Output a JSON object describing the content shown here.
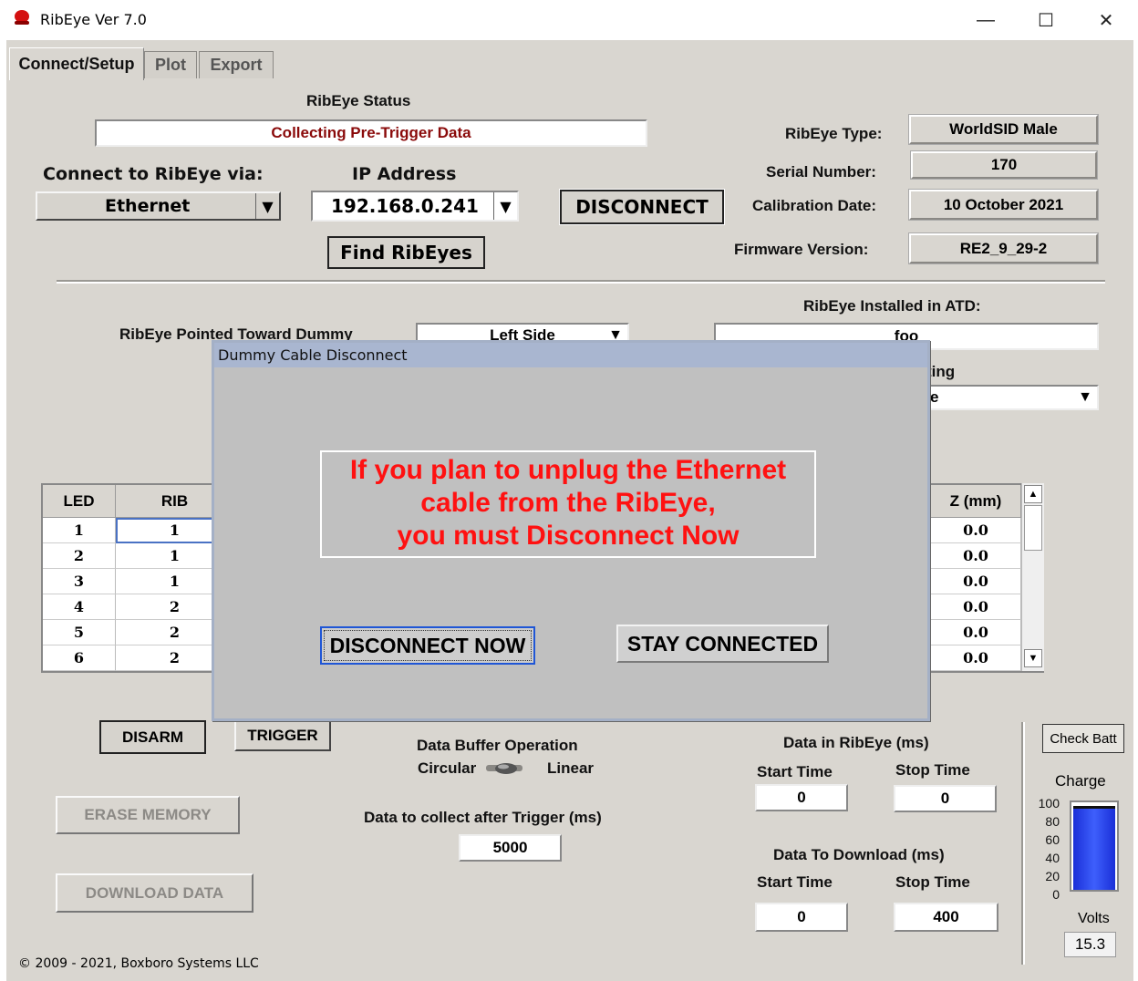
{
  "window": {
    "title": "RibEye Ver 7.0",
    "minimize": "—",
    "maximize": "☐",
    "close": "✕"
  },
  "tabs": [
    "Connect/Setup",
    "Plot",
    "Export"
  ],
  "status": {
    "heading": "RibEye Status",
    "value": "Collecting Pre-Trigger Data"
  },
  "connect": {
    "via_label": "Connect to RibEye via:",
    "via_value": "Ethernet",
    "ip_label": "IP Address",
    "ip_value": "192.168.0.241",
    "disconnect_label": "DISCONNECT",
    "find_label": "Find RibEyes"
  },
  "info": {
    "type_label": "RibEye Type:",
    "type_value": "WorldSID Male",
    "serial_label": "Serial Number:",
    "serial_value": "170",
    "cal_label": "Calibration Date:",
    "cal_value": "10 October 2021",
    "fw_label": "Firmware Version:",
    "fw_value": "RE2_9_29-2"
  },
  "setup": {
    "pointed_label": "RibEye Pointed Toward Dummy",
    "pointed_value": "Left Side",
    "installed_label": "RibEye Installed in ATD:",
    "installed_value": "foo",
    "setting_label_partial": "ting",
    "setting_value_partial": "e"
  },
  "table": {
    "headers": {
      "led": "LED",
      "rib": "RIB",
      "z": "Z (mm)"
    },
    "rows": [
      {
        "led": "1",
        "rib": "1",
        "z": "0.0"
      },
      {
        "led": "2",
        "rib": "1",
        "z": "0.0"
      },
      {
        "led": "3",
        "rib": "1",
        "z": "0.0"
      },
      {
        "led": "4",
        "rib": "2",
        "z": "0.0"
      },
      {
        "led": "5",
        "rib": "2",
        "z": "0.0"
      },
      {
        "led": "6",
        "rib": "2",
        "z": "0.0"
      }
    ]
  },
  "dialog": {
    "title": "Dummy Cable Disconnect",
    "message_line1": "If you plan to unplug the Ethernet",
    "message_line2": "cable  from the RibEye,",
    "message_line3": "you must Disconnect Now",
    "disconnect_now": "DISCONNECT NOW",
    "stay_connected": "STAY CONNECTED"
  },
  "controls": {
    "disarm": "DISARM",
    "trigger": "TRIGGER",
    "erase": "ERASE MEMORY",
    "download": "DOWNLOAD DATA",
    "buffer_label": "Data Buffer Operation",
    "circular": "Circular",
    "linear": "Linear",
    "after_trigger_label": "Data to collect after Trigger (ms)",
    "after_trigger_value": "5000"
  },
  "data_in": {
    "label": "Data in RibEye (ms)",
    "start_label": "Start Time",
    "start_value": "0",
    "stop_label": "Stop Time",
    "stop_value": "0"
  },
  "download": {
    "label": "Data To Download (ms)",
    "start_label": "Start Time",
    "start_value": "0",
    "stop_label": "Stop Time",
    "stop_value": "400"
  },
  "battery": {
    "check_label": "Check Batt",
    "charge_label": "Charge",
    "ticks": [
      "100",
      "80",
      "60",
      "40",
      "20",
      "0"
    ],
    "charge_percent": 98,
    "volts_label": "Volts",
    "volts_value": "15.3",
    "fill_color": "#2741e8"
  },
  "footer": {
    "copyright": "© 2009 - 2021, Boxboro Systems LLC"
  }
}
